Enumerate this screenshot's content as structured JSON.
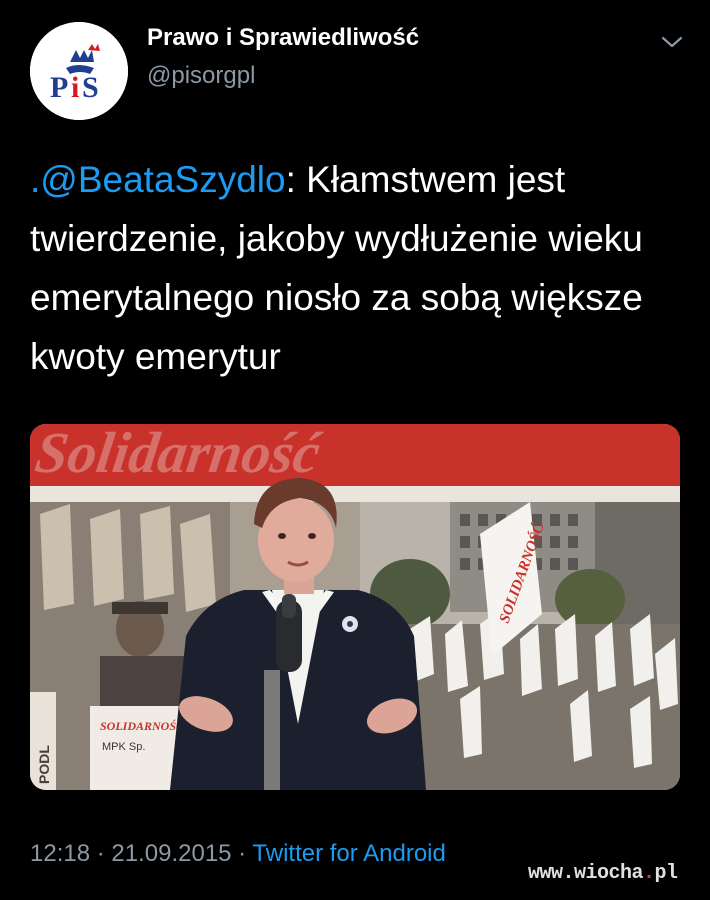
{
  "author": {
    "avatar_logo_text": "PiS",
    "display_name": "Prawo i Sprawiedliwość",
    "handle": "@pisorgpl"
  },
  "tweet": {
    "mention": ".@BeataSzydlo",
    "lines": [
      ": Kłamstwem jest",
      "twierdzenie, jakoby wydłużenie wieku",
      "emerytalnego niosło za sobą większe",
      "kwoty emerytur"
    ],
    "media": {
      "banner_text": "Solidarność",
      "flag_text_1": "SOLIDARNOŚĆ",
      "flag_text_2": "SOLIDARNOŚĆ",
      "sign_text": "MPK Sp.",
      "sign_text_2": "PODL"
    }
  },
  "meta": {
    "time": "12:18",
    "separator": " · ",
    "date": "21.09.2015",
    "source": "Twitter for Android"
  },
  "watermark": {
    "prefix": "www.wiocha",
    "dot": ".",
    "suffix": "pl"
  },
  "colors": {
    "background": "#000000",
    "link": "#1d9bf0",
    "secondary": "#8b98a5",
    "pis_blue": "#1f3f8f",
    "pis_red": "#d71920",
    "banner_red": "#c8322b"
  },
  "icons": {
    "menu": "chevron-down-icon",
    "logo": "pis-logo-icon"
  }
}
